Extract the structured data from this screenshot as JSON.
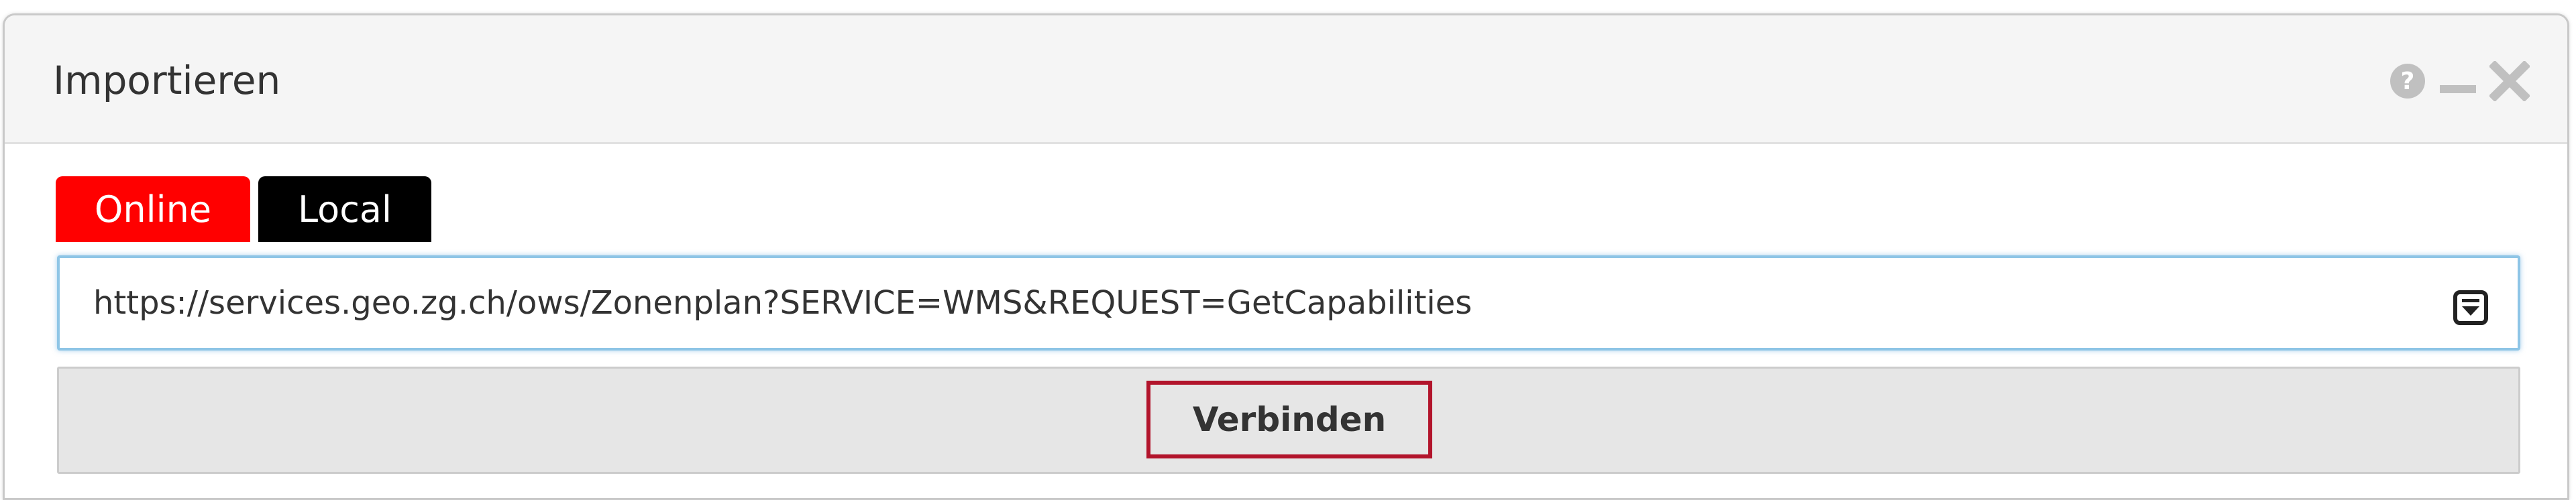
{
  "dialog": {
    "title": "Importieren",
    "controls": {
      "help_icon": "help-icon",
      "minimize_icon": "minimize-icon",
      "close_icon": "close-icon"
    }
  },
  "tabs": [
    {
      "label": "Online",
      "active": true,
      "color": "#ff0000"
    },
    {
      "label": "Local",
      "active": false,
      "color": "#000000"
    }
  ],
  "url_field": {
    "value": "https://services.geo.zg.ch/ows/Zonenplan?SERVICE=WMS&REQUEST=GetCapabilities",
    "dropdown_icon": "dropdown-box-icon",
    "focus_color": "#8ec5e6"
  },
  "connect": {
    "label": "Verbinden",
    "highlight_color": "#b2142b"
  }
}
